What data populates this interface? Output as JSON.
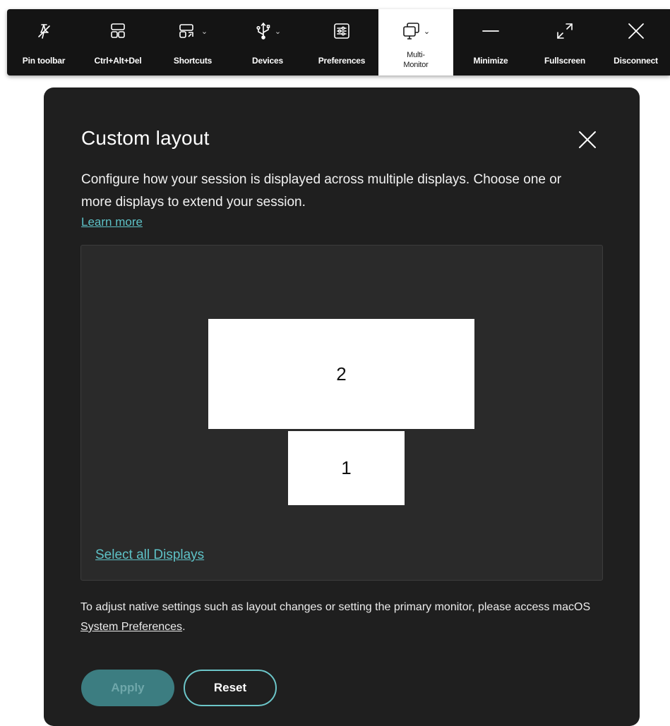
{
  "toolbar": {
    "items": [
      {
        "label": "Pin toolbar",
        "icon": "pin-icon",
        "has_dropdown": false
      },
      {
        "label": "Ctrl+Alt+Del",
        "icon": "ctrl-alt-del-icon",
        "has_dropdown": false
      },
      {
        "label": "Shortcuts",
        "icon": "shortcuts-icon",
        "has_dropdown": true
      },
      {
        "label": "Devices",
        "icon": "usb-icon",
        "has_dropdown": true
      },
      {
        "label": "Preferences",
        "icon": "preferences-icon",
        "has_dropdown": false
      },
      {
        "label": "Multi-\nMonitor",
        "icon": "multi-monitor-icon",
        "has_dropdown": true,
        "active": true
      },
      {
        "label": "Minimize",
        "icon": "minimize-icon",
        "has_dropdown": false
      },
      {
        "label": "Fullscreen",
        "icon": "fullscreen-icon",
        "has_dropdown": false
      },
      {
        "label": "Disconnect",
        "icon": "close-icon",
        "has_dropdown": false
      }
    ],
    "caret": "⌄"
  },
  "dialog": {
    "title": "Custom layout",
    "description": "Configure how your session is displayed across multiple displays. Choose one or more displays to extend your session.",
    "learn_more": "Learn more",
    "displays": [
      {
        "number": "2"
      },
      {
        "number": "1"
      }
    ],
    "select_all": "Select all Displays",
    "note_prefix": "To adjust native settings such as layout changes or setting the primary monitor, please access macOS ",
    "note_link": "System Preferences",
    "note_suffix": ".",
    "apply_label": "Apply",
    "reset_label": "Reset"
  },
  "colors": {
    "toolbar_bg": "#141414",
    "dialog_bg": "#1f1f1f",
    "accent": "#5ec2c7",
    "apply_bg": "#3c7d81"
  }
}
